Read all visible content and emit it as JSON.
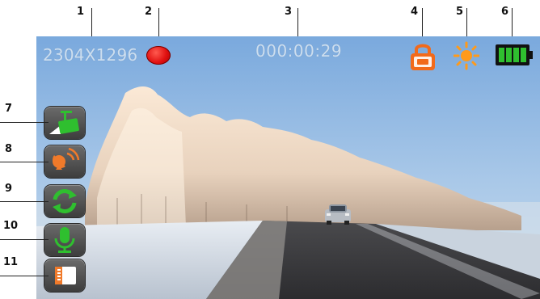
{
  "callouts": [
    "1",
    "2",
    "3",
    "4",
    "5",
    "6",
    "7",
    "8",
    "9",
    "10",
    "11"
  ],
  "hud": {
    "resolution": "2304X1296",
    "elapsed_time": "000:00:29",
    "battery_level": 1.0
  },
  "icons": {
    "recording": "recording-dot-icon",
    "lock": "lock-icon",
    "exposure": "sun-icon",
    "battery": "battery-icon",
    "side": [
      "camera-mode-icon",
      "motion-detection-icon",
      "loop-recording-icon",
      "microphone-icon",
      "memory-card-icon"
    ]
  },
  "colors": {
    "record": "#e01010",
    "lock": "#f26a1b",
    "sun": "#ff9a1a",
    "battery_fill": "#2fbf2f",
    "icon_green": "#2fbf2f",
    "icon_orange": "#f07a2a",
    "hud_text": "#d6e4f1"
  }
}
